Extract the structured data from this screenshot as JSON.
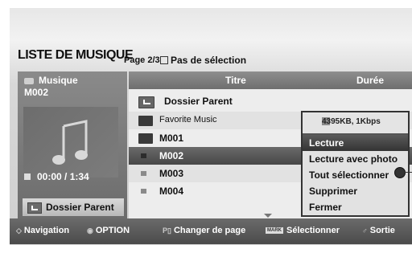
{
  "header": {
    "title": "LISTE DE MUSIQUE",
    "page": "Page 2/3",
    "selection": "Pas de sélection"
  },
  "left_panel": {
    "category": "Musique",
    "track": "M002",
    "time": "00:00 / 1:34",
    "parent_button": "Dossier Parent"
  },
  "list": {
    "columns": {
      "title": "Titre",
      "duration": "Durée"
    },
    "rows": [
      {
        "label": "Dossier Parent",
        "type": "parent"
      },
      {
        "label": "Favorite Music",
        "type": "folder"
      },
      {
        "label": "M001",
        "type": "folder"
      },
      {
        "label": "M002",
        "type": "music"
      },
      {
        "label": "M003",
        "type": "music"
      },
      {
        "label": "M004",
        "type": "music"
      }
    ]
  },
  "popup": {
    "info": "4395KB, 1Kbps",
    "items": [
      "Lecture",
      "Lecture avec photo",
      "Tout sélectionner",
      "Supprimer",
      "Fermer"
    ],
    "highlighted": "Lecture"
  },
  "bottom": {
    "navigation": "Navigation",
    "option": "OPTION",
    "page_change": "Changer de page",
    "mark_key": "MARK",
    "select": "Sélectionner",
    "exit": "Sortie"
  },
  "colors": {
    "selected_row": "#474747",
    "bar": "#5a5a5a",
    "background": "#f2f2f2"
  }
}
